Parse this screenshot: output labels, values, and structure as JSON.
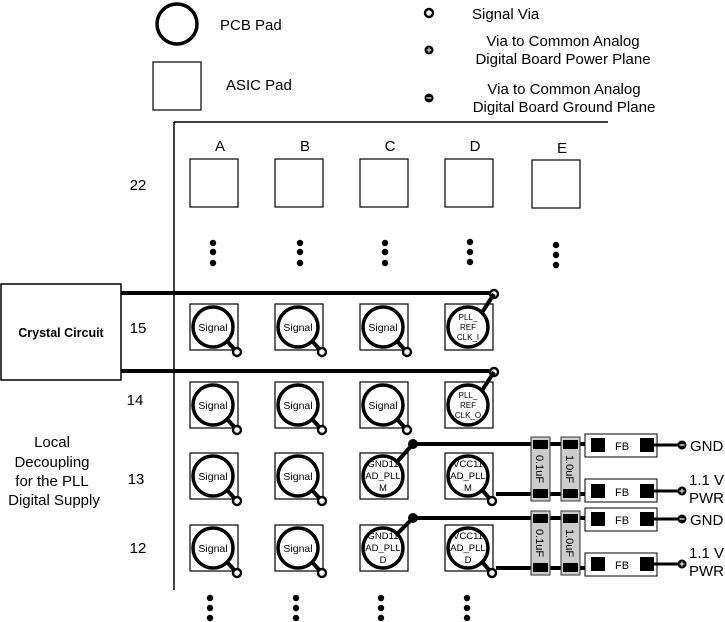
{
  "legend": {
    "pcb_pad": "PCB Pad",
    "asic_pad": "ASIC Pad",
    "signal_via": "Signal Via",
    "power_via": [
      "Via to Common Analog",
      "Digital Board Power Plane"
    ],
    "ground_via": [
      "Via to Common Analog",
      "Digital Board Ground Plane"
    ]
  },
  "columns": [
    "A",
    "B",
    "C",
    "D",
    "E"
  ],
  "rows": [
    "22",
    "15",
    "14",
    "13",
    "12"
  ],
  "crystal_circuit": "Crystal Circuit",
  "decoupling_label": [
    "Local",
    "Decoupling",
    "for the PLL",
    "Digital Supply"
  ],
  "pads": {
    "row15": [
      [
        "Signal"
      ],
      [
        "Signal"
      ],
      [
        "Signal"
      ],
      [
        "PLL_",
        "REF",
        "CLK_I"
      ]
    ],
    "row14": [
      [
        "Signal"
      ],
      [
        "Signal"
      ],
      [
        "Signal"
      ],
      [
        "PLL_",
        "REF",
        "CLK_O"
      ]
    ],
    "row13": [
      [
        "Signal"
      ],
      [
        "Signal"
      ],
      [
        "GND11",
        "AD_PLL",
        "M"
      ],
      [
        "VCC11",
        "AD_PLL",
        "M"
      ]
    ],
    "row12": [
      [
        "Signal"
      ],
      [
        "Signal"
      ],
      [
        "GND11",
        "AD_PLL",
        "D"
      ],
      [
        "VCC11",
        "AD_PLL",
        "D"
      ]
    ]
  },
  "capacitors": [
    "0.1uF",
    "1.0uF"
  ],
  "ferrite_bead": "FB",
  "outputs": {
    "gnd": "GND",
    "pwr": [
      "1.1 V",
      "PWR"
    ]
  },
  "colors": {
    "capacitor_fill": "#cccccc",
    "line": "#000000"
  }
}
